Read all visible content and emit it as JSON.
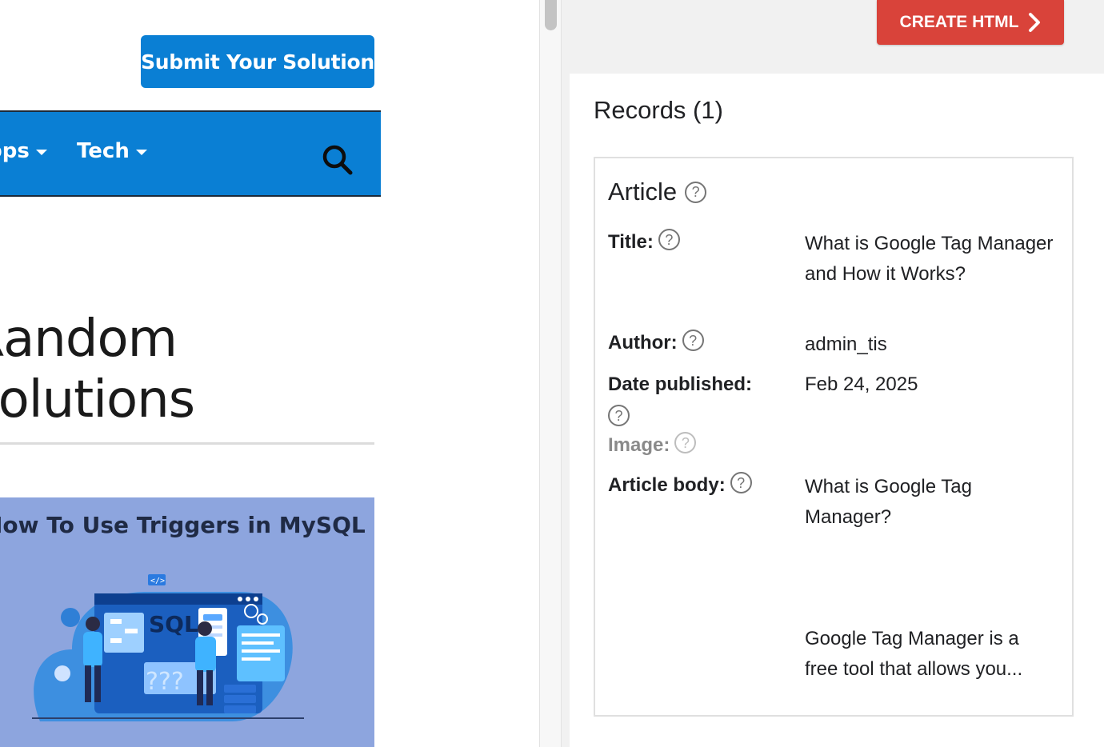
{
  "website": {
    "submit_button": "Submit Your Solution",
    "nav": [
      {
        "label": "Apps"
      },
      {
        "label": "Tech"
      }
    ],
    "heading_line1": "Random",
    "heading_line2": "Solutions",
    "post_thumbnail": {
      "title": "How To Use Triggers in MySQL",
      "art_text_sql": "SQL",
      "art_text_q": "???",
      "art_text_code": "</>"
    }
  },
  "rich_results": {
    "create_button": "CREATE HTML",
    "records_heading": "Records (1)",
    "article": {
      "type": "Article",
      "help_glyph": "?",
      "fields": {
        "title_label": "Title:",
        "title_value": "What is Google Tag Manager and How it Works?",
        "author_label": "Author:",
        "author_value": "admin_tis",
        "date_label": "Date published:",
        "date_value": "Feb 24, 2025",
        "image_label": "Image:",
        "body_label": "Article body:",
        "body_value_1": "What is Google Tag Manager?",
        "body_value_2": "Google Tag Manager is a free tool that allows you..."
      }
    }
  },
  "colors": {
    "brand_blue": "#0a7fd4",
    "create_red": "#d9433a",
    "thumb_bg": "#8da5de"
  },
  "icons": {
    "search": "search-icon",
    "chevron": "chevron-right-icon",
    "help": "help-icon",
    "caret": "caret-down-icon"
  }
}
